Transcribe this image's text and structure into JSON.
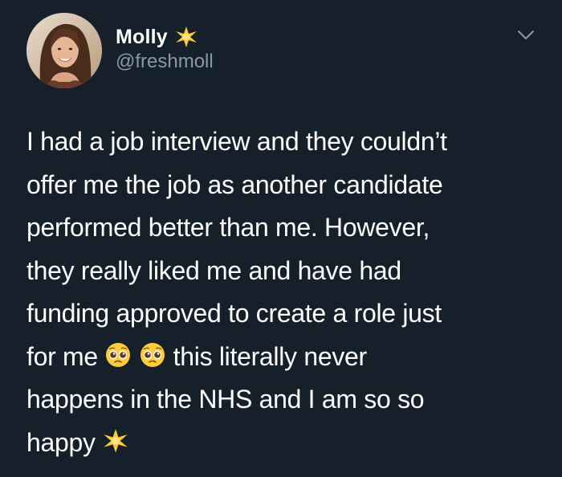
{
  "author": {
    "name": "Molly",
    "handle": "@freshmoll",
    "badge_icon": "sparkle-star-icon"
  },
  "menu_icon": "chevron-down-icon",
  "tweet": {
    "lines": [
      "I had a job interview and they couldn’t",
      "offer me the job as another candidate",
      "performed better than me. However,",
      "they really liked me and have had",
      "funding approved to create a role just",
      "for me",
      "this literally never",
      "happens in the NHS and I am so so",
      "happy"
    ],
    "emojis": [
      "pleading-face-icon",
      "pleading-face-icon",
      "sparkle-star-icon"
    ]
  },
  "colors": {
    "background": "#15202b",
    "text": "#ffffff",
    "secondary": "#8899a6",
    "star": "#ffcc3e"
  }
}
